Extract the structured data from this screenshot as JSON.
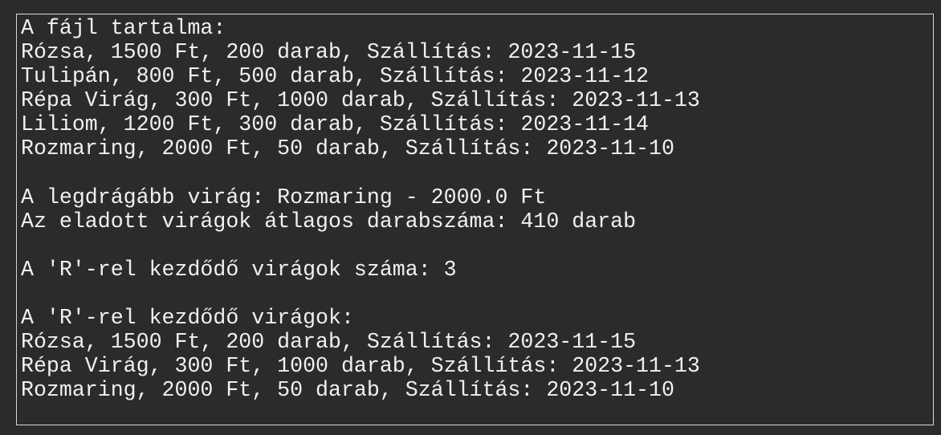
{
  "output": {
    "lines": [
      "A fájl tartalma:",
      "Rózsa, 1500 Ft, 200 darab, Szállítás: 2023-11-15",
      "Tulipán, 800 Ft, 500 darab, Szállítás: 2023-11-12",
      "Répa Virág, 300 Ft, 1000 darab, Szállítás: 2023-11-13",
      "Liliom, 1200 Ft, 300 darab, Szállítás: 2023-11-14",
      "Rozmaring, 2000 Ft, 50 darab, Szállítás: 2023-11-10",
      "",
      "A legdrágább virág: Rozmaring - 2000.0 Ft",
      "Az eladott virágok átlagos darabszáma: 410 darab",
      "",
      "A 'R'-rel kezdődő virágok száma: 3",
      "",
      "A 'R'-rel kezdődő virágok:",
      "Rózsa, 1500 Ft, 200 darab, Szállítás: 2023-11-15",
      "Répa Virág, 300 Ft, 1000 darab, Szállítás: 2023-11-13",
      "Rozmaring, 2000 Ft, 50 darab, Szállítás: 2023-11-10"
    ]
  }
}
